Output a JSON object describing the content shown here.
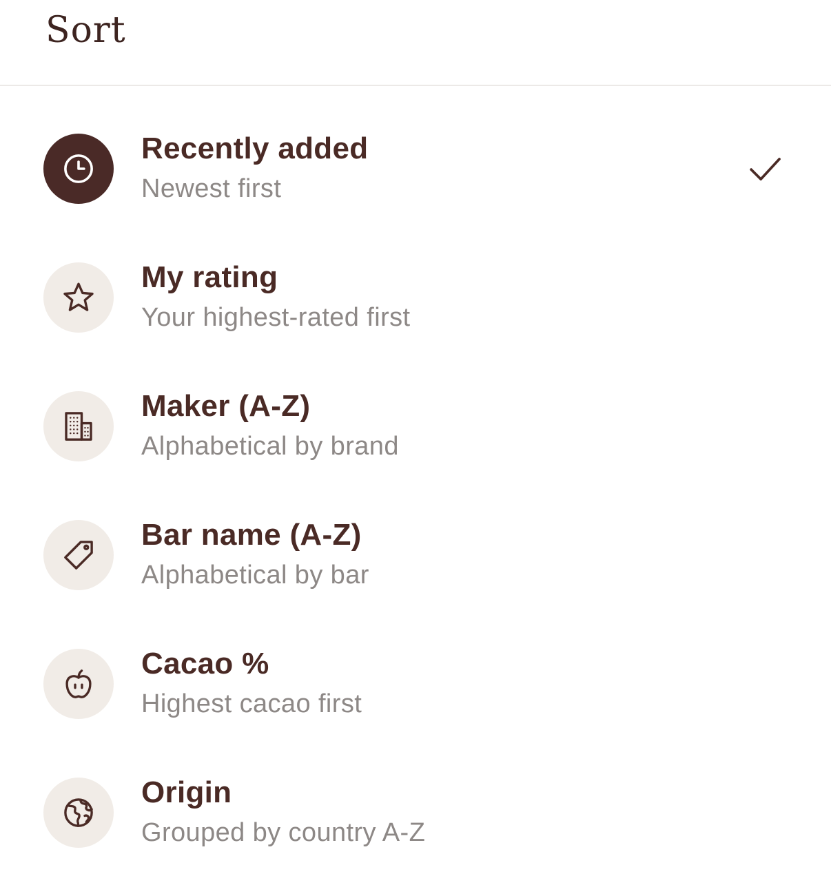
{
  "header": {
    "title": "Sort"
  },
  "sort_options": [
    {
      "label": "Recently added",
      "description": "Newest first",
      "icon": "clock-icon",
      "selected": true
    },
    {
      "label": "My rating",
      "description": "Your highest-rated first",
      "icon": "star-icon",
      "selected": false
    },
    {
      "label": "Maker (A-Z)",
      "description": "Alphabetical by brand",
      "icon": "building-icon",
      "selected": false
    },
    {
      "label": "Bar name (A-Z)",
      "description": "Alphabetical by bar",
      "icon": "tag-icon",
      "selected": false
    },
    {
      "label": "Cacao %",
      "description": "Highest cacao first",
      "icon": "apple-icon",
      "selected": false
    },
    {
      "label": "Origin",
      "description": "Grouped by country A-Z",
      "icon": "globe-icon",
      "selected": false
    }
  ],
  "colors": {
    "accent": "#4a2a27",
    "icon_bg": "#f1ece7",
    "title_text": "#4a2a25",
    "subtitle_text": "#8d8886",
    "divider": "#ece9e7"
  }
}
